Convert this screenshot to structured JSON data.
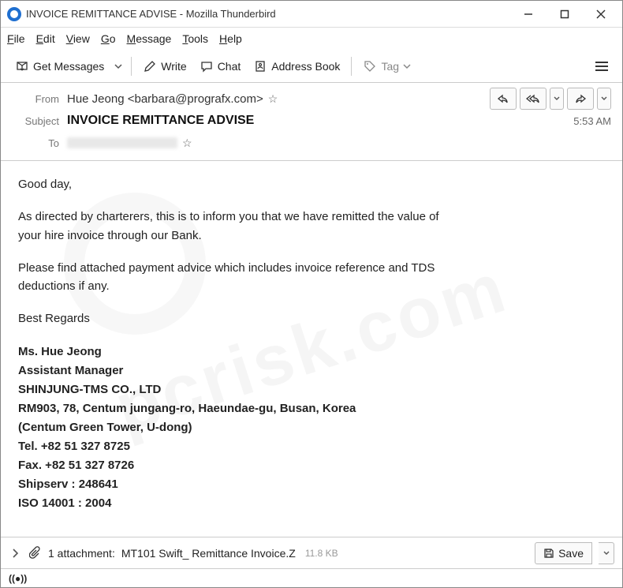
{
  "window": {
    "title": "INVOICE REMITTANCE ADVISE - Mozilla Thunderbird"
  },
  "menu": {
    "file": "File",
    "edit": "Edit",
    "view": "View",
    "go": "Go",
    "message": "Message",
    "tools": "Tools",
    "help": "Help"
  },
  "toolbar": {
    "get_messages": "Get Messages",
    "write": "Write",
    "chat": "Chat",
    "address_book": "Address Book",
    "tag": "Tag"
  },
  "header": {
    "from_label": "From",
    "from_value": "Hue Jeong <barbara@prografx.com>",
    "subject_label": "Subject",
    "subject_value": "INVOICE REMITTANCE ADVISE",
    "to_label": "To",
    "time": "5:53 AM"
  },
  "body": {
    "greeting": "Good day,",
    "p1": "As directed by charterers, this is to inform you that we have remitted the value of your hire invoice through our Bank.",
    "p2": "Please find attached payment advice which includes invoice reference and TDS deductions if any.",
    "closing": "Best  Regards",
    "sig_name": "Ms. Hue Jeong",
    "sig_title": "Assistant Manager",
    "sig_company": "SHINJUNG-TMS CO., LTD",
    "sig_addr": "RM903, 78, Centum jungang-ro, Haeundae-gu, Busan, Korea",
    "sig_addr2": "(Centum Green Tower, U-dong)",
    "sig_tel": "Tel. +82 51 327 8725",
    "sig_fax": "Fax. +82 51 327 8726",
    "sig_ship": "Shipserv : 248641",
    "sig_iso": "ISO 14001 : 2004"
  },
  "attachment": {
    "count_label": "1 attachment:",
    "name": "MT101 Swift_ Remittance Invoice.Z",
    "size": "11.8 KB",
    "save": "Save"
  }
}
